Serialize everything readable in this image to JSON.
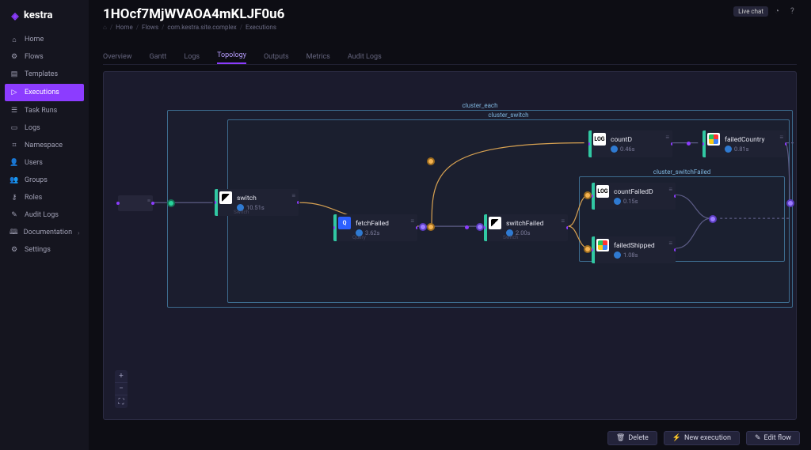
{
  "brand": "kestra",
  "sidebar": {
    "items": [
      {
        "label": "Home",
        "icon": "⌂"
      },
      {
        "label": "Flows",
        "icon": "⚙"
      },
      {
        "label": "Templates",
        "icon": "▤"
      },
      {
        "label": "Executions",
        "icon": "▷",
        "active": true
      },
      {
        "label": "Task Runs",
        "icon": "☰"
      },
      {
        "label": "Logs",
        "icon": "▭"
      },
      {
        "label": "Namespace",
        "icon": "⌗"
      },
      {
        "label": "Users",
        "icon": "👤"
      },
      {
        "label": "Groups",
        "icon": "👥"
      },
      {
        "label": "Roles",
        "icon": "⚷"
      },
      {
        "label": "Audit Logs",
        "icon": "✎"
      },
      {
        "label": "Documentation",
        "icon": "🕮",
        "chev": true
      },
      {
        "label": "Settings",
        "icon": "⚙"
      }
    ]
  },
  "header": {
    "title": "1HOcf7MjWVAOA4mKLJF0u6",
    "crumbs": [
      "Home",
      "Flows",
      "com.kestra.site.complex",
      "Executions"
    ],
    "live_chat": "Live chat"
  },
  "tabs": [
    "Overview",
    "Gantt",
    "Logs",
    "Topology",
    "Outputs",
    "Metrics",
    "Audit Logs"
  ],
  "active_tab": "Topology",
  "clusters": {
    "each": "cluster_each",
    "switch": "cluster_switch",
    "failed": "cluster_switchFailed"
  },
  "nodes": {
    "switch": {
      "name": "switch",
      "dur": "10.51s",
      "cap": "Switch"
    },
    "fetchFailed": {
      "name": "fetchFailed",
      "dur": "3.62s",
      "cap": "Query"
    },
    "countD": {
      "name": "countD",
      "dur": "0.46s",
      "cap": ""
    },
    "switchFailed": {
      "name": "switchFailed",
      "dur": "2.00s",
      "cap": "Switch"
    },
    "countFailedD": {
      "name": "countFailedD",
      "dur": "0.15s",
      "cap": ""
    },
    "failedShipped": {
      "name": "failedShipped",
      "dur": "1.08s",
      "cap": ""
    },
    "failedCountry": {
      "name": "failedCountry",
      "dur": "0.81s",
      "cap": ""
    }
  },
  "zoom": [
    "+",
    "−",
    "⛶"
  ],
  "footer": {
    "delete": "Delete",
    "new_exec": "New execution",
    "edit_flow": "Edit flow"
  }
}
